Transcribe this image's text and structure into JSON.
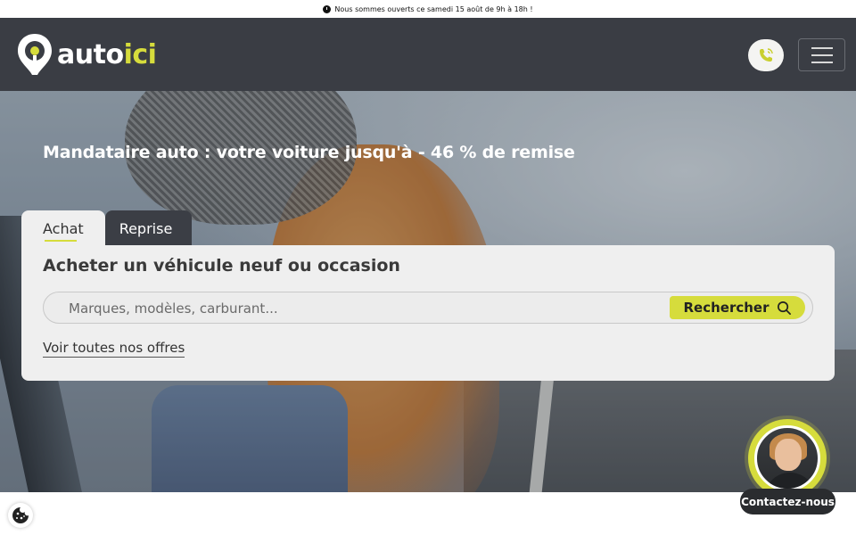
{
  "announcement": {
    "text": "Nous sommes ouverts ce samedi 15 août de 9h à 18h !",
    "icon": "clock-icon"
  },
  "header": {
    "logo": {
      "part1": "auto",
      "part2": "ici",
      "accent_color": "#d6dc3c"
    },
    "phone_icon": "phone-icon",
    "menu_icon": "hamburger-icon",
    "background": "#3a3d44"
  },
  "hero": {
    "headline": "Mandataire auto : votre voiture jusqu'à - 46  % de remise"
  },
  "search_panel": {
    "tabs": [
      {
        "label": "Achat",
        "active": true
      },
      {
        "label": "Reprise",
        "active": false
      }
    ],
    "title": "Acheter un véhicule neuf ou occasion",
    "search": {
      "placeholder": "Marques, modèles, carburant...",
      "value": ""
    },
    "search_button": {
      "label": "Rechercher",
      "icon": "search-icon"
    },
    "offers_link": "Voir toutes nos offres"
  },
  "cookie_icon": "cookie-icon",
  "contact_widget": {
    "label": "Contactez-nous"
  }
}
